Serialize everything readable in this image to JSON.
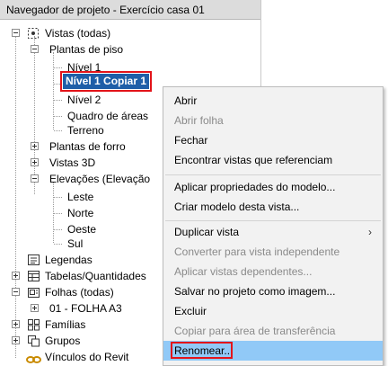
{
  "panel": {
    "title": "Navegador de projeto - Exercício casa 01"
  },
  "tree": {
    "views_all": "Vistas (todas)",
    "floor_plans": "Plantas de piso",
    "level1": "Nível 1",
    "level1_copy": "Nível 1 Copiar 1",
    "level2": "Nível 2",
    "areas_frame": "Quadro de áreas",
    "terrain": "Terreno",
    "ceiling_plans": "Plantas de forro",
    "views_3d": "Vistas 3D",
    "elevations": "Elevações (Elevação",
    "east": "Leste",
    "north": "Norte",
    "west": "Oeste",
    "south": "Sul",
    "legends": "Legendas",
    "schedules": "Tabelas/Quantidades",
    "sheets_all": "Folhas (todas)",
    "sheet01": "01 - FOLHA A3",
    "families": "Famílias",
    "groups": "Grupos",
    "revit_links": "Vínculos do Revit"
  },
  "context_menu": {
    "open": "Abrir",
    "open_sheet": "Abrir folha",
    "close": "Fechar",
    "find_refs": "Encontrar vistas que referenciam",
    "apply_props": "Aplicar propriedades do modelo...",
    "create_template": "Criar modelo desta vista...",
    "duplicate_view": "Duplicar vista",
    "convert_independent": "Converter para vista independente",
    "apply_dependent": "Aplicar vistas dependentes...",
    "save_image": "Salvar no projeto como imagem...",
    "delete": "Excluir",
    "copy_clipboard": "Copiar para área de transferência",
    "rename": "Renomear...",
    "submenu_arrow": "›"
  },
  "colors": {
    "selection": "#1f5fa8",
    "highlight_box": "#e3141a",
    "menu_hover": "#91c9f7"
  }
}
